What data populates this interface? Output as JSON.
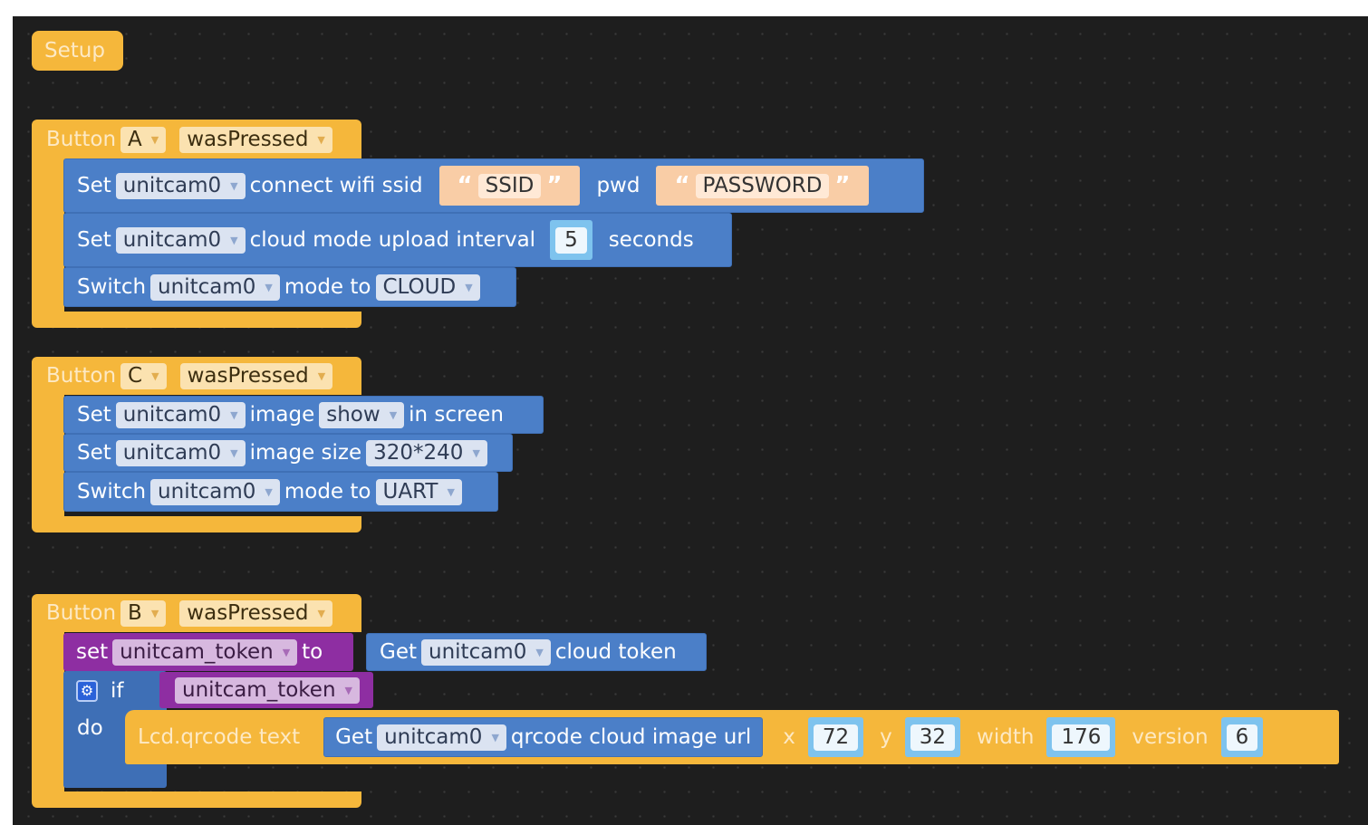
{
  "setup": {
    "label": "Setup"
  },
  "handlers": [
    {
      "button_label": "Button",
      "button": "A",
      "event": "wasPressed",
      "rows": [
        {
          "set": "Set",
          "device": "unitcam0",
          "text": "connect wifi ssid",
          "ssid": "SSID",
          "pwd_label": "pwd",
          "pwd": "PASSWORD"
        },
        {
          "set": "Set",
          "device": "unitcam0",
          "text": "cloud mode upload interval",
          "value": "5",
          "unit": "seconds"
        },
        {
          "set": "Switch",
          "device": "unitcam0",
          "text": "mode to",
          "mode": "CLOUD"
        }
      ]
    },
    {
      "button_label": "Button",
      "button": "C",
      "event": "wasPressed",
      "rows": [
        {
          "set": "Set",
          "device": "unitcam0",
          "text": "image",
          "option": "show",
          "text2": "in screen"
        },
        {
          "set": "Set",
          "device": "unitcam0",
          "text": "image size",
          "option": "320*240"
        },
        {
          "set": "Switch",
          "device": "unitcam0",
          "text": "mode to",
          "mode": "UART"
        }
      ]
    },
    {
      "button_label": "Button",
      "button": "B",
      "event": "wasPressed",
      "set_var": {
        "set": "set",
        "var": "unitcam_token",
        "to": "to",
        "get": "Get",
        "device": "unitcam0",
        "text": "cloud token"
      },
      "if_block": {
        "if": "if",
        "do": "do",
        "var": "unitcam_token"
      },
      "qrcode": {
        "label": "Lcd.qrcode text",
        "get": "Get",
        "device": "unitcam0",
        "text": "qrcode cloud image url",
        "x_label": "x",
        "x": "72",
        "y_label": "y",
        "y": "32",
        "width_label": "width",
        "width": "176",
        "version_label": "version",
        "version": "6"
      }
    }
  ],
  "icons": {
    "dropdown": "dropdown-arrow-icon",
    "gear": "gear-icon",
    "quote_open": "“",
    "quote_close": "”"
  },
  "colors": {
    "event": "#f5b73b",
    "action": "#4b7fc8",
    "variable": "#8e2ea2",
    "string": "#f9cda6",
    "number": "#7ec3ee",
    "background": "#1e1e1e"
  }
}
